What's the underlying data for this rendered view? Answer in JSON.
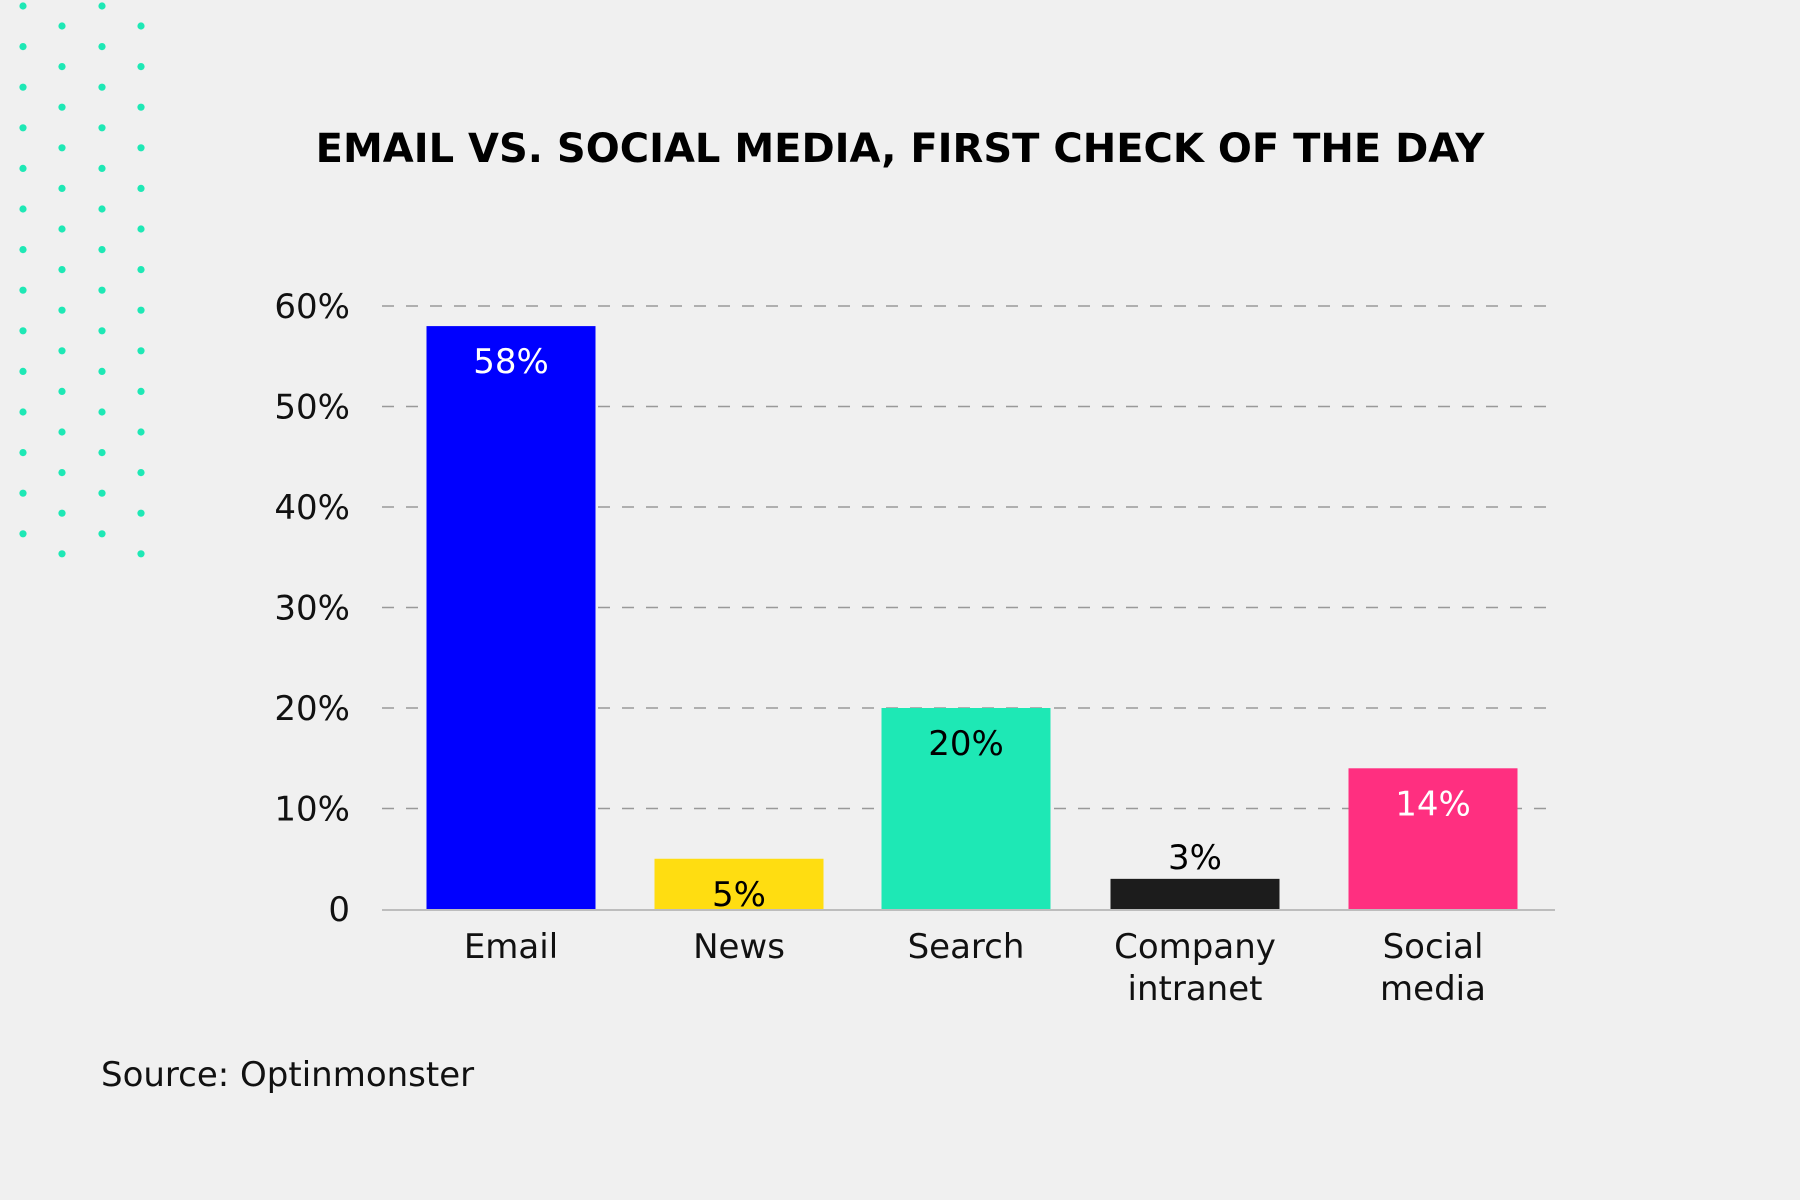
{
  "chart_data": {
    "type": "bar",
    "title": "EMAIL VS. SOCIAL MEDIA, FIRST CHECK OF THE DAY",
    "xlabel": "",
    "ylabel": "",
    "ylim": [
      0,
      60
    ],
    "yticks": [
      0,
      10,
      20,
      30,
      40,
      50,
      60
    ],
    "ytick_labels": [
      "0",
      "10%",
      "20%",
      "30%",
      "40%",
      "50%",
      "60%"
    ],
    "grid": "horizontal-dashed",
    "categories": [
      [
        "Email"
      ],
      [
        "News"
      ],
      [
        "Search"
      ],
      [
        "Company",
        "intranet"
      ],
      [
        "Social",
        "media"
      ]
    ],
    "values": [
      58,
      5,
      20,
      3,
      14
    ],
    "value_labels": [
      "58%",
      "5%",
      "20%",
      "3%",
      "14%"
    ],
    "colors": [
      "#0000ff",
      "#ffdd11",
      "#1ee8b5",
      "#1c1c1c",
      "#ff2f80"
    ],
    "label_colors": [
      "#ffffff",
      "#000000",
      "#000000",
      "#000000",
      "#ffffff"
    ],
    "label_inside": [
      true,
      true,
      true,
      false,
      true
    ],
    "legend": "none"
  },
  "source": "Source: Optinmonster",
  "decoration": {
    "dot_color": "#1ee8b5"
  }
}
